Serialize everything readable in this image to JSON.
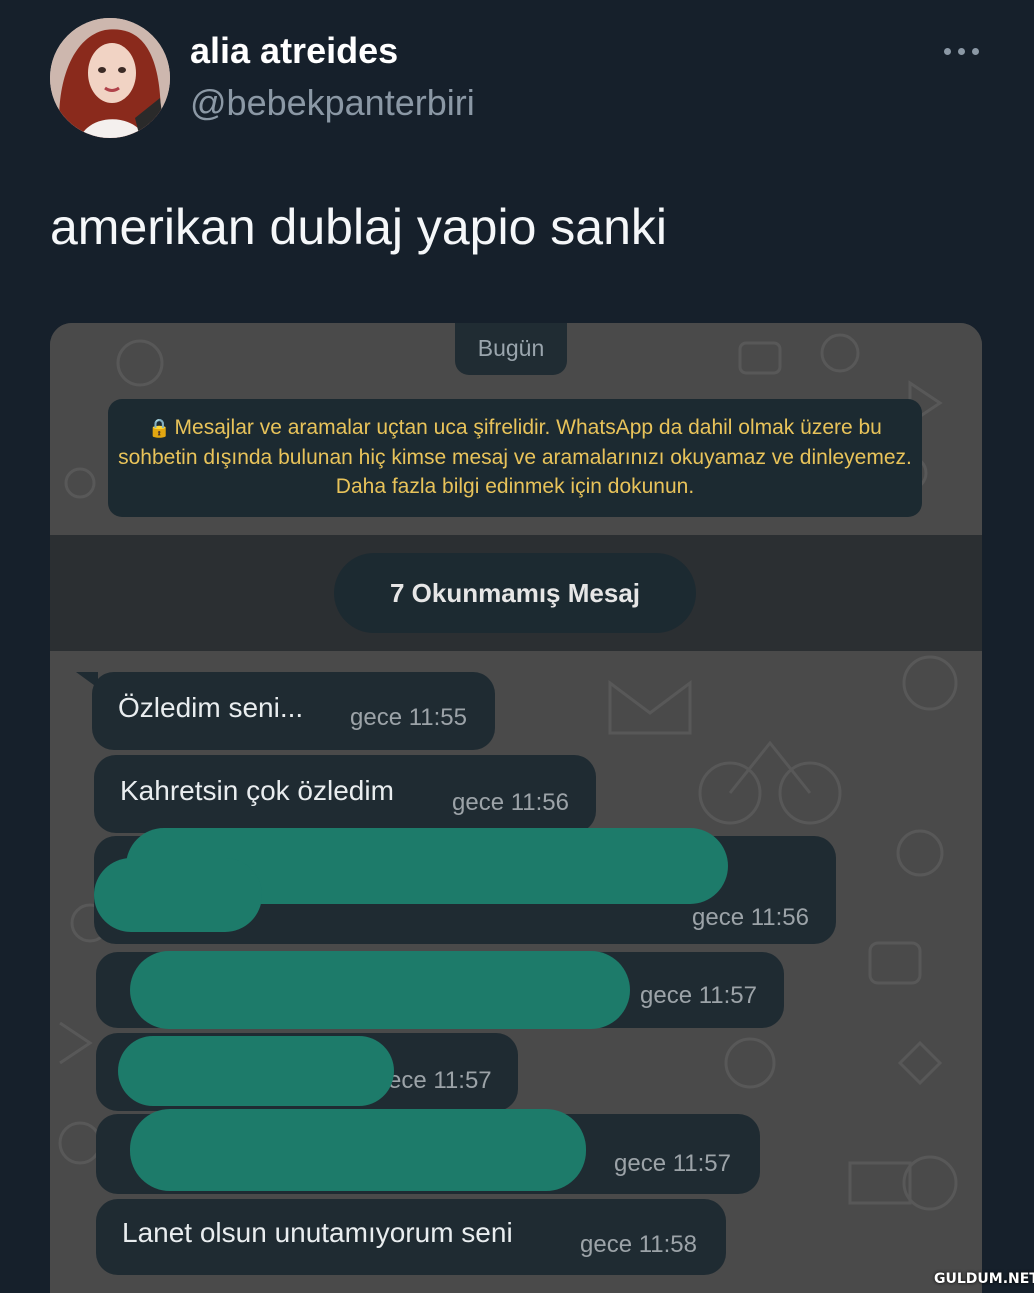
{
  "tweet": {
    "display_name": "alia atreides",
    "handle": "@bebekpanterbiri",
    "text": "amerikan dublaj yapio sanki",
    "more_icon": "ellipsis-icon"
  },
  "chat": {
    "date_label": "Bugün",
    "encryption_notice": "Mesajlar ve aramalar uçtan uca şifrelidir. WhatsApp da dahil olmak üzere bu sohbetin dışında bulunan hiç kimse mesaj ve aramalarınızı okuyamaz ve dinleyemez. Daha fazla bilgi edinmek için dokunun.",
    "encryption_icon": "lock-icon",
    "unread_label": "7 Okunmamış Mesaj",
    "messages": [
      {
        "text": "Özledim seni...",
        "time": "gece 11:55"
      },
      {
        "text": "Kahretsin çok özledim",
        "time": "gece 11:56"
      },
      {
        "text": "",
        "time": "gece 11:56",
        "redacted": true
      },
      {
        "text": "",
        "time": "gece 11:57",
        "redacted": true
      },
      {
        "text": "",
        "time": "ece 11:57",
        "redacted": true
      },
      {
        "text": "",
        "time": "gece 11:57",
        "redacted": true
      },
      {
        "text": "Lanet olsun unutamıyorum seni",
        "time": "gece 11:58"
      }
    ],
    "redaction_color": "#1d7b6a",
    "bubble_color": "#1f2b32"
  },
  "watermark": "GULDUM.NET"
}
